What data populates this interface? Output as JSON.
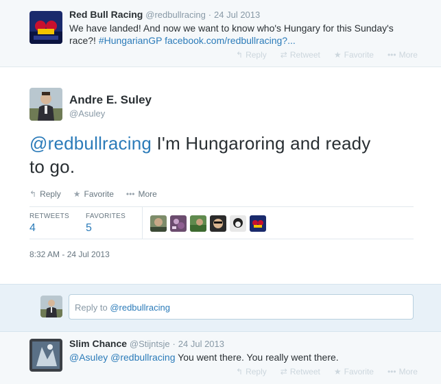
{
  "context_tweet": {
    "fullname": "Red Bull Racing",
    "screenname": "@redbullracing",
    "separator": "·",
    "time": "24 Jul 2013",
    "text_line1": "We have landed! And now we want to know who's Hungary for this Sunday's",
    "text_plain2": "race?! ",
    "hashtag": "#HungarianGP",
    "link": "facebook.com/redbullracing?...",
    "actions": {
      "reply": "Reply",
      "retweet": "Retweet",
      "favorite": "Favorite",
      "more": "More"
    }
  },
  "main_tweet": {
    "fullname": "Andre E. Suley",
    "screenname": "@Asuley",
    "mention": "@redbullracing",
    "text_line1_rest": " I'm Hungaroring and ready",
    "text_line2": "to go.",
    "actions": {
      "reply": "Reply",
      "favorite": "Favorite",
      "more": "More"
    },
    "stats": {
      "retweets_label": "RETWEETS",
      "retweets_value": "4",
      "favorites_label": "FAVORITES",
      "favorites_value": "5"
    },
    "timestamp": "8:32 AM - 24 Jul 2013"
  },
  "reply_box": {
    "placeholder_prefix": "Reply to ",
    "placeholder_mention": "@redbullracing"
  },
  "reply_tweet": {
    "fullname": "Slim Chance",
    "screenname": "@Stijntsje",
    "separator": "·",
    "time": "24 Jul 2013",
    "mention1": "@Asuley",
    "mention2": "@redbullracing",
    "text_rest": " You went there. You really went there.",
    "actions": {
      "reply": "Reply",
      "retweet": "Retweet",
      "favorite": "Favorite",
      "more": "More"
    }
  },
  "colors": {
    "link": "#2b7bb9",
    "muted": "#8899a6",
    "reply_area": "#e8f1f8"
  }
}
